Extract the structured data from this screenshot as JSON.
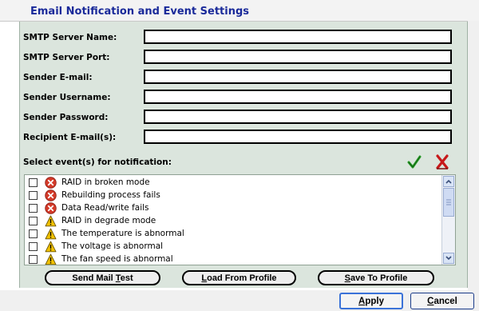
{
  "header": {
    "title": "Email Notification and Event Settings"
  },
  "form": {
    "fields": [
      {
        "label": "SMTP Server Name:",
        "value": ""
      },
      {
        "label": "SMTP Server Port:",
        "value": ""
      },
      {
        "label": "Sender E-mail:",
        "value": ""
      },
      {
        "label": "Sender Username:",
        "value": ""
      },
      {
        "label": "Sender Password:",
        "value": ""
      },
      {
        "label": "Recipient E-mail(s):",
        "value": ""
      }
    ]
  },
  "events": {
    "label": "Select event(s) for notification:",
    "check_all_icon": "green-checkmark-icon",
    "clear_all_icon": "red-x-icon",
    "items": [
      {
        "text": "RAID in broken mode",
        "severity": "error",
        "checked": false
      },
      {
        "text": "Rebuilding process fails",
        "severity": "error",
        "checked": false
      },
      {
        "text": "Data Read/write fails",
        "severity": "error",
        "checked": false
      },
      {
        "text": "RAID in degrade mode",
        "severity": "warning",
        "checked": false
      },
      {
        "text": "The temperature is abnormal",
        "severity": "warning",
        "checked": false
      },
      {
        "text": "The voltage is abnormal",
        "severity": "warning",
        "checked": false
      },
      {
        "text": "The fan speed is abnormal",
        "severity": "warning",
        "checked": false
      }
    ]
  },
  "actions": {
    "send_mail_test": {
      "before": "Send Mail ",
      "ul": "T",
      "after": "est"
    },
    "load_from_profile": {
      "before": "",
      "ul": "L",
      "after": "oad From Profile"
    },
    "save_to_profile": {
      "before": "",
      "ul": "S",
      "after": "ave To Profile"
    }
  },
  "footer": {
    "apply": {
      "ul": "A",
      "after": "pply"
    },
    "cancel": {
      "ul": "C",
      "after": "ancel"
    }
  },
  "colors": {
    "title": "#1a2a9a",
    "panel_bg": "#dbe5dd",
    "error": "#d43b2a",
    "warning": "#f2c200",
    "check": "#2ca02c"
  }
}
